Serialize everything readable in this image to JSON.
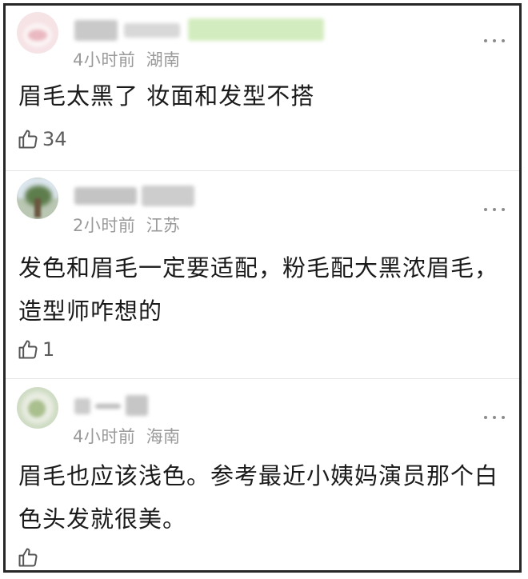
{
  "comments": [
    {
      "time": "4小时前",
      "location": "湖南",
      "text": "眉毛太黑了 妆面和发型不搭",
      "likes": "34"
    },
    {
      "time": "2小时前",
      "location": "江苏",
      "text": "发色和眉毛一定要适配，粉毛配大黑浓眉毛，造型师咋想的",
      "likes": "1"
    },
    {
      "time": "4小时前",
      "location": "海南",
      "text": "眉毛也应该浅色。参考最近小姨妈演员那个白色头发就很美。",
      "likes": ""
    }
  ],
  "icons": {
    "more": "more-dots-icon",
    "like": "thumbs-up-icon"
  }
}
